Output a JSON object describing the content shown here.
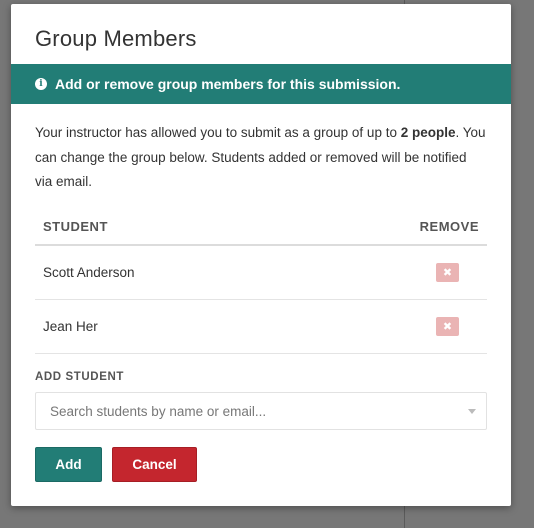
{
  "modal": {
    "title": "Group Members",
    "banner_text": "Add or remove group members for this submission.",
    "intro_before": "Your instructor has allowed you to submit as a group of up to ",
    "intro_bold": "2 people",
    "intro_after": ". You can change the group below. Students added or removed will be notified via email."
  },
  "table": {
    "col_student": "STUDENT",
    "col_remove": "REMOVE",
    "rows": [
      {
        "name": "Scott Anderson"
      },
      {
        "name": "Jean Her"
      }
    ]
  },
  "add_student": {
    "label": "ADD STUDENT",
    "placeholder": "Search students by name or email..."
  },
  "buttons": {
    "add_label": "Add",
    "cancel_label": "Cancel"
  },
  "icons": {
    "info": "info-icon",
    "remove": "close-icon",
    "dropdown": "chevron-down-icon"
  },
  "colors": {
    "primary": "#227d76",
    "danger": "#c4262e",
    "remove_bg": "#eab4b4"
  }
}
